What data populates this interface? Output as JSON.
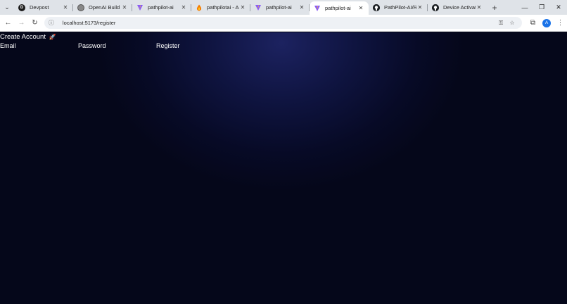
{
  "browser": {
    "tabs": [
      {
        "title": "Devpost",
        "favicon": "devpost-icon",
        "active": false
      },
      {
        "title": "OpenAI Build W",
        "favicon": "openai-icon",
        "active": false
      },
      {
        "title": "pathpilot-ai",
        "favicon": "vite-icon",
        "active": false
      },
      {
        "title": "pathpilotai - Aut",
        "favicon": "firebase-icon",
        "active": false
      },
      {
        "title": "pathpilot-ai",
        "favicon": "vite-icon",
        "active": false
      },
      {
        "title": "pathpilot-ai",
        "favicon": "vite-icon",
        "active": true
      },
      {
        "title": "PathPilot-AI/RE/",
        "favicon": "github-icon",
        "active": false
      },
      {
        "title": "Device Activatio",
        "favicon": "github-icon",
        "active": false
      }
    ],
    "url": "localhost:5173/register",
    "profile_initial": "A"
  },
  "page": {
    "title": "Create Account",
    "title_emoji": "🚀",
    "email_label": "Email",
    "password_label": "Password",
    "register_label": "Register"
  },
  "colors": {
    "background": "#05071a",
    "glow": "#1c2260",
    "text": "#ffffff"
  }
}
